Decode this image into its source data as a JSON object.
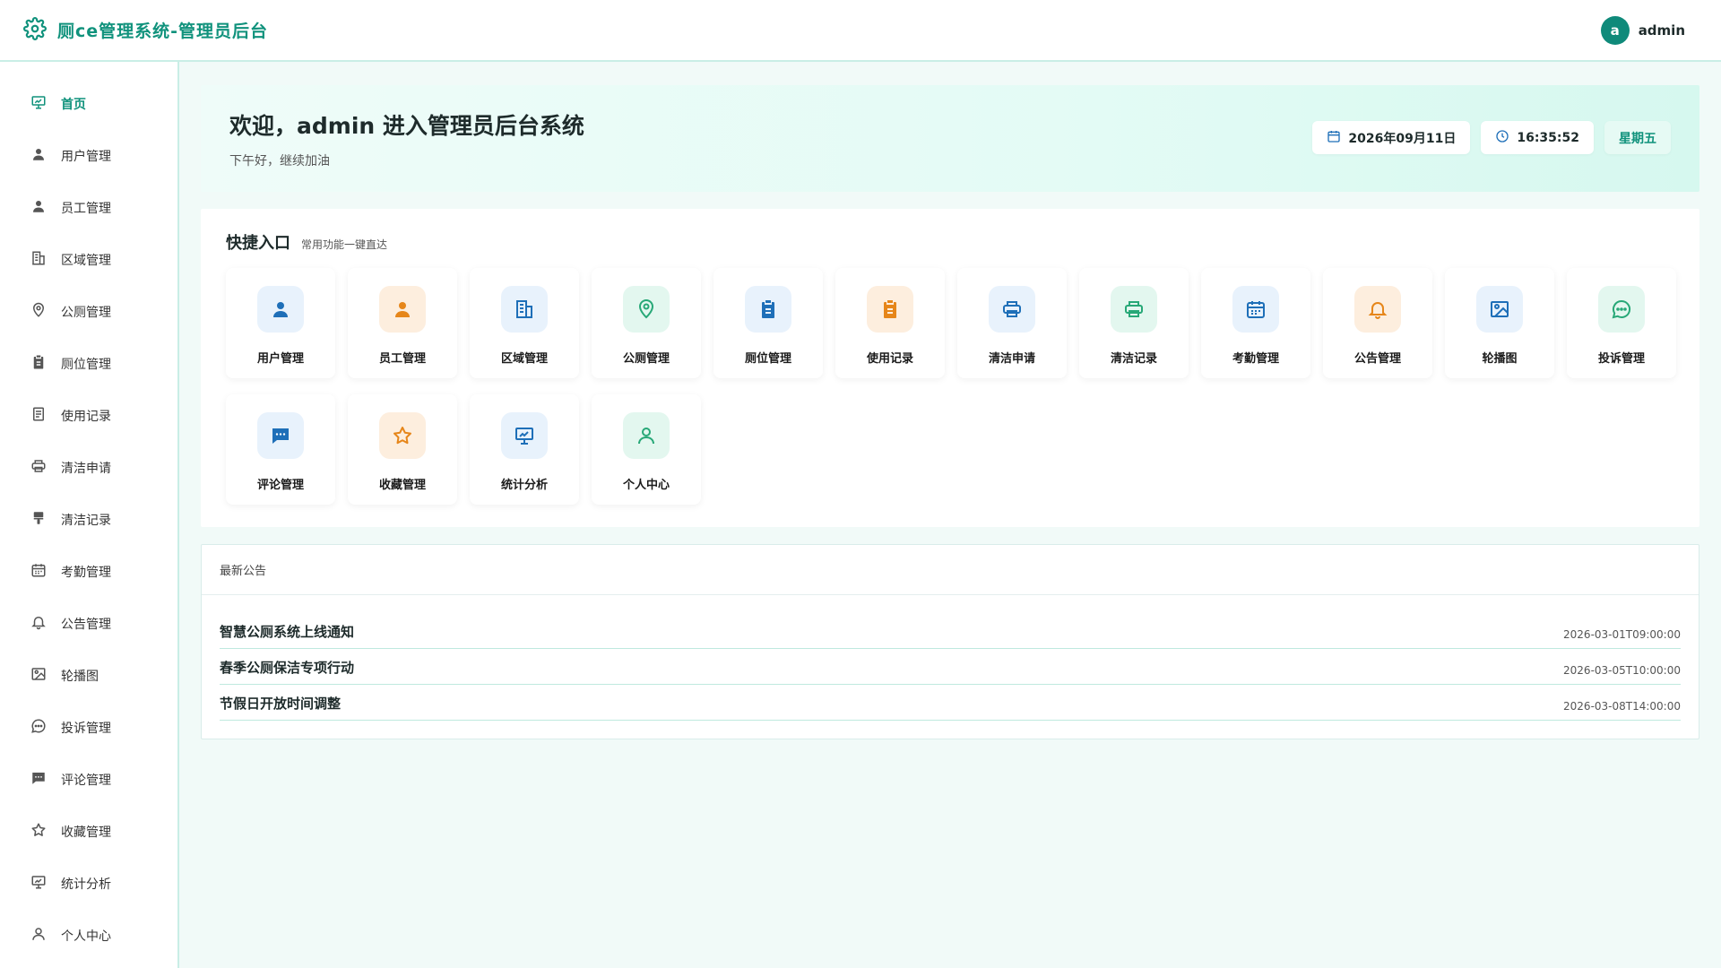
{
  "header": {
    "title": "厕ce管理系统-管理员后台",
    "user_initial": "a",
    "user_name": "admin"
  },
  "sidebar": {
    "items": [
      {
        "label": "首页",
        "icon": "chart-board-icon",
        "active": true
      },
      {
        "label": "用户管理",
        "icon": "user-icon"
      },
      {
        "label": "员工管理",
        "icon": "user-icon"
      },
      {
        "label": "区域管理",
        "icon": "building-icon"
      },
      {
        "label": "公厕管理",
        "icon": "location-icon"
      },
      {
        "label": "厕位管理",
        "icon": "clipboard-icon"
      },
      {
        "label": "使用记录",
        "icon": "document-icon"
      },
      {
        "label": "清洁申请",
        "icon": "printer-icon"
      },
      {
        "label": "清洁记录",
        "icon": "brush-icon"
      },
      {
        "label": "考勤管理",
        "icon": "calendar-icon"
      },
      {
        "label": "公告管理",
        "icon": "bell-icon"
      },
      {
        "label": "轮播图",
        "icon": "picture-icon"
      },
      {
        "label": "投诉管理",
        "icon": "chat-dots-icon"
      },
      {
        "label": "评论管理",
        "icon": "comment-icon"
      },
      {
        "label": "收藏管理",
        "icon": "star-icon"
      },
      {
        "label": "统计分析",
        "icon": "chart-board-icon"
      },
      {
        "label": "个人中心",
        "icon": "user-outline-icon"
      }
    ]
  },
  "welcome": {
    "title": "欢迎，admin 进入管理员后台系统",
    "subtitle": "下午好，继续加油",
    "date": "2026年09月11日",
    "time": "16:35:52",
    "weekday": "星期五"
  },
  "quick": {
    "title": "快捷入口",
    "subtitle": "常用功能一键直达",
    "items": [
      {
        "label": "用户管理",
        "icon": "user-icon",
        "tone": "blue"
      },
      {
        "label": "员工管理",
        "icon": "user-icon",
        "tone": "orange"
      },
      {
        "label": "区域管理",
        "icon": "building-icon",
        "tone": "blue"
      },
      {
        "label": "公厕管理",
        "icon": "location-icon",
        "tone": "green"
      },
      {
        "label": "厕位管理",
        "icon": "clipboard-icon",
        "tone": "blue"
      },
      {
        "label": "使用记录",
        "icon": "clipboard-icon",
        "tone": "orange"
      },
      {
        "label": "清洁申请",
        "icon": "printer-icon",
        "tone": "blue"
      },
      {
        "label": "清洁记录",
        "icon": "printer-icon",
        "tone": "green"
      },
      {
        "label": "考勤管理",
        "icon": "calendar-icon",
        "tone": "blue"
      },
      {
        "label": "公告管理",
        "icon": "bell-icon",
        "tone": "orange"
      },
      {
        "label": "轮播图",
        "icon": "picture-icon",
        "tone": "blue"
      },
      {
        "label": "投诉管理",
        "icon": "chat-dots-icon",
        "tone": "green"
      },
      {
        "label": "评论管理",
        "icon": "comment-icon",
        "tone": "blue"
      },
      {
        "label": "收藏管理",
        "icon": "star-icon",
        "tone": "orange"
      },
      {
        "label": "统计分析",
        "icon": "chart-board-icon",
        "tone": "blue"
      },
      {
        "label": "个人中心",
        "icon": "user-outline-icon",
        "tone": "green"
      }
    ]
  },
  "notice": {
    "title": "最新公告",
    "items": [
      {
        "title": "智慧公厕系统上线通知",
        "time": "2026-03-01T09:00:00"
      },
      {
        "title": "春季公厕保洁专项行动",
        "time": "2026-03-05T10:00:00"
      },
      {
        "title": "节假日开放时间调整",
        "time": "2026-03-08T14:00:00"
      }
    ]
  },
  "colors": {
    "brand": "#10927c",
    "background": "#f1faf8",
    "blue": "#1e6fb8",
    "orange": "#e6861a",
    "green": "#27a877"
  }
}
